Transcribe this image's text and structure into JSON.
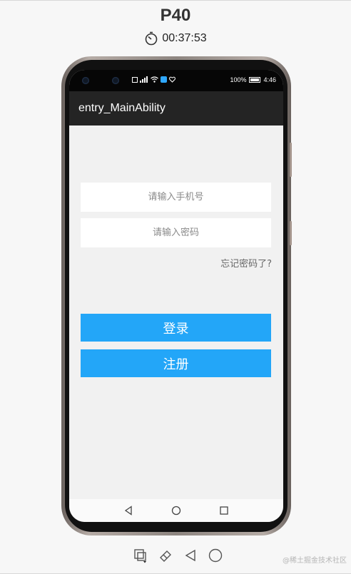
{
  "device": {
    "name": "P40",
    "timer": "00:37:53"
  },
  "status_bar": {
    "battery": "100%",
    "time": "4:46"
  },
  "app": {
    "title": "entry_MainAbility"
  },
  "login_form": {
    "phone_placeholder": "请输入手机号",
    "password_placeholder": "请输入密码",
    "forgot_label": "忘记密码了?",
    "login_label": "登录",
    "register_label": "注册"
  },
  "colors": {
    "accent": "#23a6f8",
    "app_bar": "#242424",
    "screen_bg": "#f1f1f1"
  },
  "watermark": "@稀土掘金技术社区"
}
